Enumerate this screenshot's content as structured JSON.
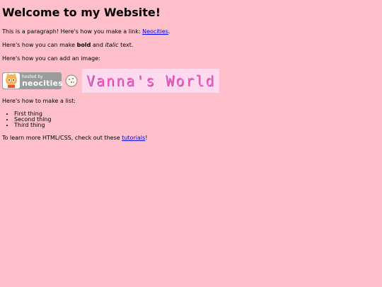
{
  "page": {
    "heading": "Welcome to my Website!",
    "p1_text": "This is a paragraph! Here's how you make a link: ",
    "p1_link": "Neocities",
    "p1_end": ".",
    "p2_prefix": "Here's how you can make ",
    "p2_bold": "bold",
    "p2_middle": " and ",
    "p2_italic": "italic",
    "p2_end": " text.",
    "p3_text": "Here's how you can add an image:",
    "list_intro": "Here's how to make a list:",
    "list_items": [
      "First thing",
      "Second thing",
      "Third thing"
    ],
    "footer_text": "To learn more HTML/CSS, check out these ",
    "footer_link": "tutorials",
    "footer_end": "!"
  },
  "images": {
    "neocities_badge_small": "hosted by",
    "neocities_badge_big": "neocities",
    "banner_text": "Vanna's World"
  },
  "colors": {
    "background": "#ffc0cb",
    "link": "#0000ee",
    "banner_text": "#ff63c9"
  }
}
